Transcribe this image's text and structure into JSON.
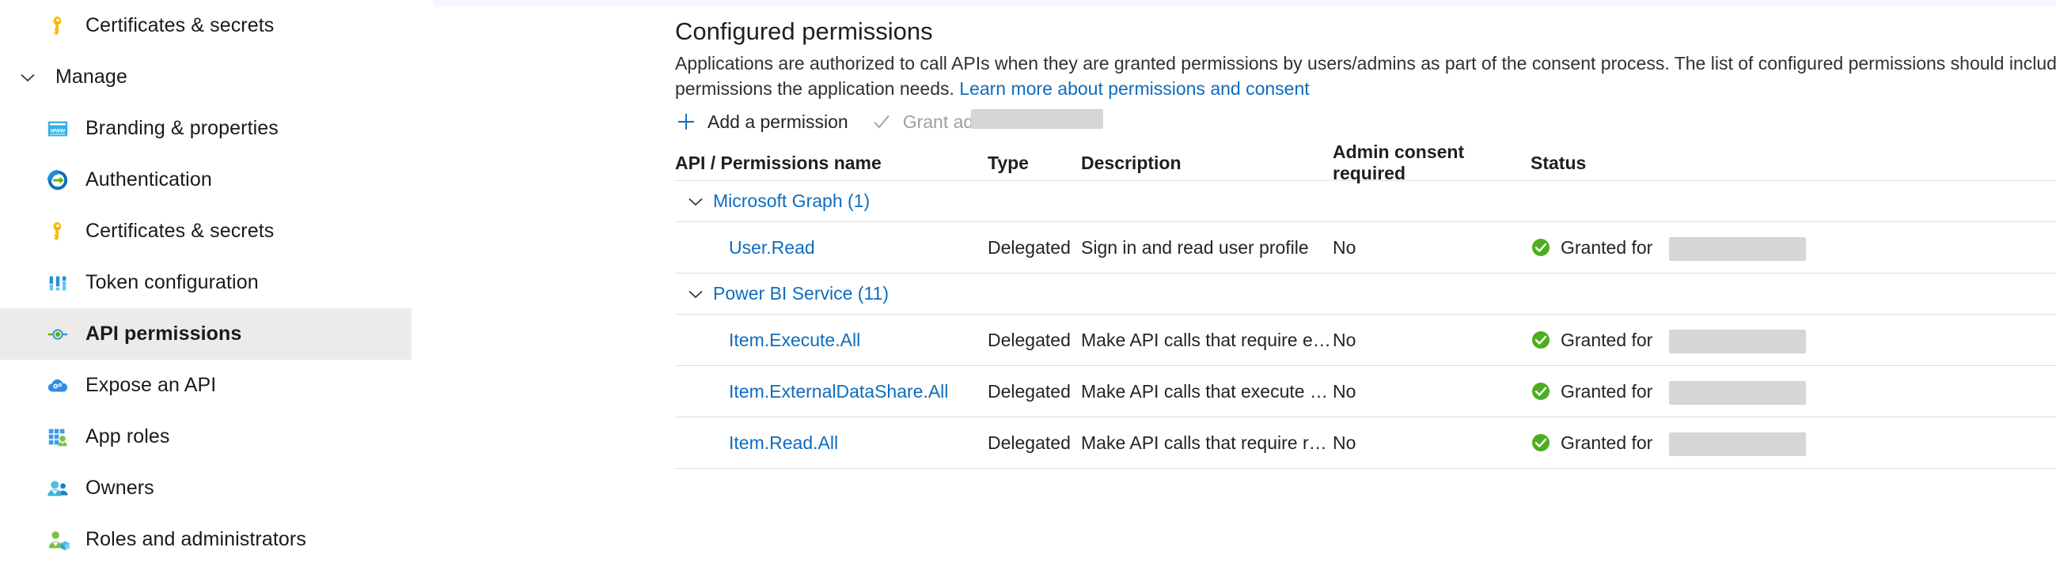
{
  "sidebar": {
    "items": [
      {
        "label": "Certificates & secrets",
        "icon": "key-icon",
        "type": "item",
        "selected": false
      },
      {
        "label": "Manage",
        "icon": "chevron-down-icon",
        "type": "group",
        "selected": false
      },
      {
        "label": "Branding & properties",
        "icon": "branding-www-icon",
        "type": "item",
        "selected": false
      },
      {
        "label": "Authentication",
        "icon": "authentication-arrow-icon",
        "type": "item",
        "selected": false
      },
      {
        "label": "Certificates & secrets",
        "icon": "key-icon",
        "type": "item",
        "selected": false
      },
      {
        "label": "Token configuration",
        "icon": "token-bars-icon",
        "type": "item",
        "selected": false
      },
      {
        "label": "API permissions",
        "icon": "api-permissions-icon",
        "type": "item",
        "selected": true
      },
      {
        "label": "Expose an API",
        "icon": "cloud-gear-icon",
        "type": "item",
        "selected": false
      },
      {
        "label": "App roles",
        "icon": "app-roles-grid-person-icon",
        "type": "item",
        "selected": false
      },
      {
        "label": "Owners",
        "icon": "owners-people-icon",
        "type": "item",
        "selected": false
      },
      {
        "label": "Roles and administrators",
        "icon": "roles-admin-person-icon",
        "type": "item",
        "selected": false
      }
    ]
  },
  "main": {
    "title": "Configured permissions",
    "description_part1": "Applications are authorized to call APIs when they are granted permissions by users/admins as part of the consent process. The list of configured permissions should include all the permissions the application needs. ",
    "description_link": "Learn more about permissions and consent",
    "toolbar": {
      "add_permission_label": "Add a permission",
      "add_permission_icon": "plus-icon",
      "grant_consent_label": "Grant admin consent fo",
      "grant_consent_icon": "checkmark-icon",
      "grant_consent_redacted": true
    },
    "table": {
      "columns": [
        "API / Permissions name",
        "Type",
        "Description",
        "Admin consent required",
        "Status"
      ],
      "rows": [
        {
          "kind": "group",
          "name": "Microsoft Graph (1)",
          "chevron": "chevron-down-icon",
          "overflow_icon": "more-options-icon"
        },
        {
          "kind": "permission",
          "name": "User.Read",
          "type": "Delegated",
          "description": "Sign in and read user profile",
          "admin_consent_required": "No",
          "status_icon": "granted-check-icon",
          "status": "Granted for",
          "status_redacted": true,
          "overflow_icon": "more-options-icon"
        },
        {
          "kind": "group",
          "name": "Power BI Service (11)",
          "chevron": "chevron-down-icon",
          "overflow_icon": "more-options-icon"
        },
        {
          "kind": "permission",
          "name": "Item.Execute.All",
          "type": "Delegated",
          "description": "Make API calls that require execute permi...",
          "admin_consent_required": "No",
          "status_icon": "granted-check-icon",
          "status": "Granted for",
          "status_redacted": true,
          "overflow_icon": "more-options-icon"
        },
        {
          "kind": "permission",
          "name": "Item.ExternalDataShare.All",
          "type": "Delegated",
          "description": "Make API calls that execute external data ...",
          "admin_consent_required": "No",
          "status_icon": "granted-check-icon",
          "status": "Granted for",
          "status_redacted": true,
          "overflow_icon": "more-options-icon"
        },
        {
          "kind": "permission",
          "name": "Item.Read.All",
          "type": "Delegated",
          "description": "Make API calls that require read permissio...",
          "admin_consent_required": "No",
          "status_icon": "granted-check-icon",
          "status": "Granted for",
          "status_redacted": true,
          "overflow_icon": "more-options-icon"
        }
      ]
    }
  },
  "colors": {
    "link": "#0f6cbd",
    "granted_green": "#4caf21",
    "selected_row_bg": "#edebe9",
    "divider": "#e1dfdd",
    "redaction": "#d6d6d6"
  }
}
